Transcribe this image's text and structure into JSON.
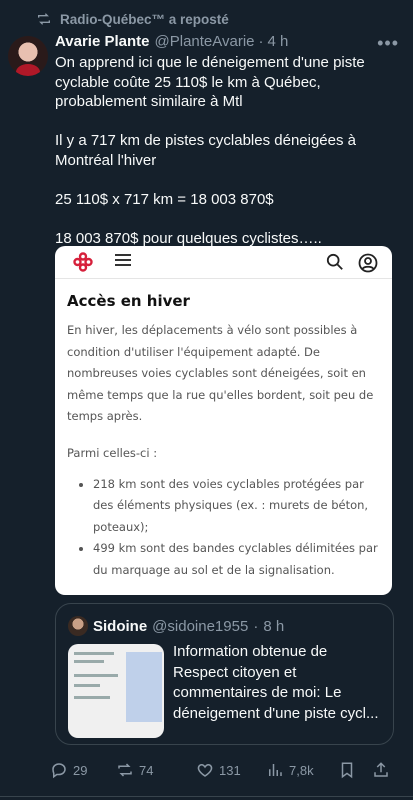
{
  "repost": {
    "label": "Radio-Québec™ a reposté"
  },
  "tweet": {
    "name": "Avarie Plante",
    "handle": "@PlanteAvarie",
    "separator": "·",
    "time": "4 h",
    "more": "•••",
    "text": "On apprend ici que le déneigement d'une piste cyclable coûte 25 110$ le km à Québec, probablement similaire à Mtl\n\nIl y a 717 km de pistes cyclables déneigées à Montréal l'hiver\n\n25 110$ x 717 km = 18 003 870$\n\n18 003 870$ pour quelques cyclistes….."
  },
  "card": {
    "title": "Accès en hiver",
    "paragraph": "En hiver, les déplacements à vélo sont possibles à condition d'utiliser l'équipement adapté. De nombreuses voies cyclables sont déneigées, soit en même temps que la rue qu'elles bordent, soit peu de temps après.",
    "subheading": "Parmi celles-ci :",
    "items": [
      "218 km sont des voies cyclables protégées par des éléments physiques (ex. : murets de béton, poteaux);",
      "499 km sont des bandes cyclables délimitées par du marquage au sol et de la signalisation."
    ]
  },
  "quote": {
    "name": "Sidoine",
    "handle": "@sidoine1955",
    "separator": "·",
    "time": "8 h",
    "text": "Information obtenue de Respect citoyen et commentaires de moi:  Le déneigement d'une piste cycl..."
  },
  "actions": {
    "replies": "29",
    "reposts": "74",
    "likes": "131",
    "views": "7,8k"
  },
  "colors": {
    "background": "#15202b",
    "text": "#f7f9f9",
    "muted": "#8b98a5",
    "repost_active": "#8b98a5"
  }
}
